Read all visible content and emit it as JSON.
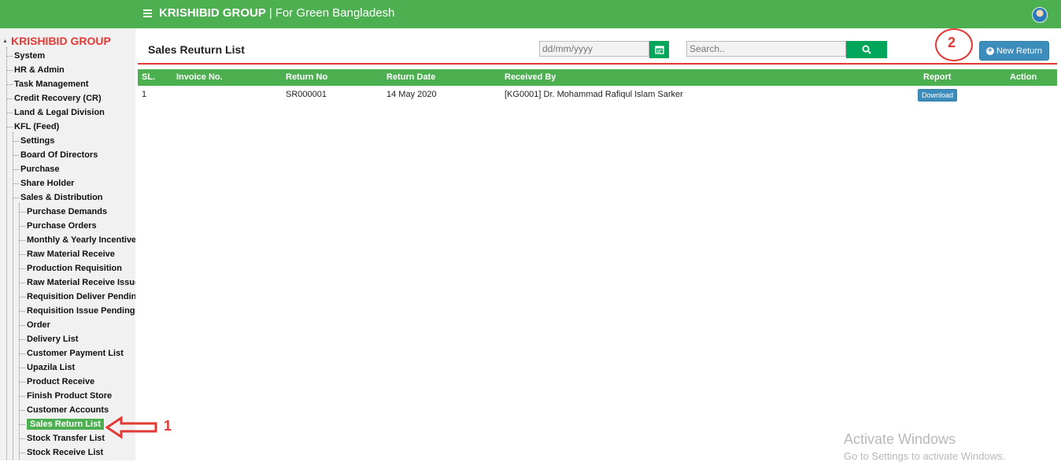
{
  "header": {
    "brand": "KRISHIBID GROUP",
    "separator": "|",
    "tagline": "For Green Bangladesh"
  },
  "sidebar": {
    "root": "KRISHIBID GROUP",
    "items": [
      {
        "label": "System"
      },
      {
        "label": "HR & Admin"
      },
      {
        "label": "Task Management"
      },
      {
        "label": "Credit Recovery (CR)"
      },
      {
        "label": "Land & Legal Division"
      },
      {
        "label": "KFL (Feed)"
      },
      {
        "label": "Settings"
      },
      {
        "label": "Board Of Directors"
      },
      {
        "label": "Purchase"
      },
      {
        "label": "Share Holder"
      },
      {
        "label": "Sales & Distribution"
      },
      {
        "label": "Purchase Demands"
      },
      {
        "label": "Purchase Orders"
      },
      {
        "label": "Monthly & Yearly Incentive"
      },
      {
        "label": "Raw Material Receive"
      },
      {
        "label": "Production Requisition"
      },
      {
        "label": "Raw Material Receive Issue"
      },
      {
        "label": "Requisition Deliver Pending"
      },
      {
        "label": "Requisition Issue Pending"
      },
      {
        "label": "Order"
      },
      {
        "label": "Delivery List"
      },
      {
        "label": "Customer Payment List"
      },
      {
        "label": "Upazila List"
      },
      {
        "label": "Product Receive"
      },
      {
        "label": "Finish Product Store"
      },
      {
        "label": "Customer Accounts"
      },
      {
        "label": "Sales Return List"
      },
      {
        "label": "Stock Transfer List"
      },
      {
        "label": "Stock Receive List"
      }
    ]
  },
  "main": {
    "title": "Sales Reuturn List",
    "date_placeholder": "dd/mm/yyyy",
    "search_placeholder": "Search..",
    "new_button": "New Return",
    "table": {
      "headers": [
        "SL.",
        "Invoice No.",
        "Return No",
        "Return Date",
        "Received By",
        "Report",
        "Action"
      ],
      "rows": [
        {
          "sl": "1",
          "invoice": "",
          "return_no": "SR000001",
          "return_date": "14 May 2020",
          "received_by": "[KG0001] Dr. Mohammad Rafiqul Islam Sarker",
          "report": "Download",
          "action": ""
        }
      ]
    }
  },
  "annotations": {
    "arrow_number": "1",
    "circle_number": "2"
  },
  "watermark": {
    "line1": "Activate Windows",
    "line2": "Go to Settings to activate Windows."
  },
  "colors": {
    "primary_green": "#4caf50",
    "button_green": "#00a65a",
    "button_blue": "#3c8dbc",
    "accent_red": "#e53935"
  }
}
